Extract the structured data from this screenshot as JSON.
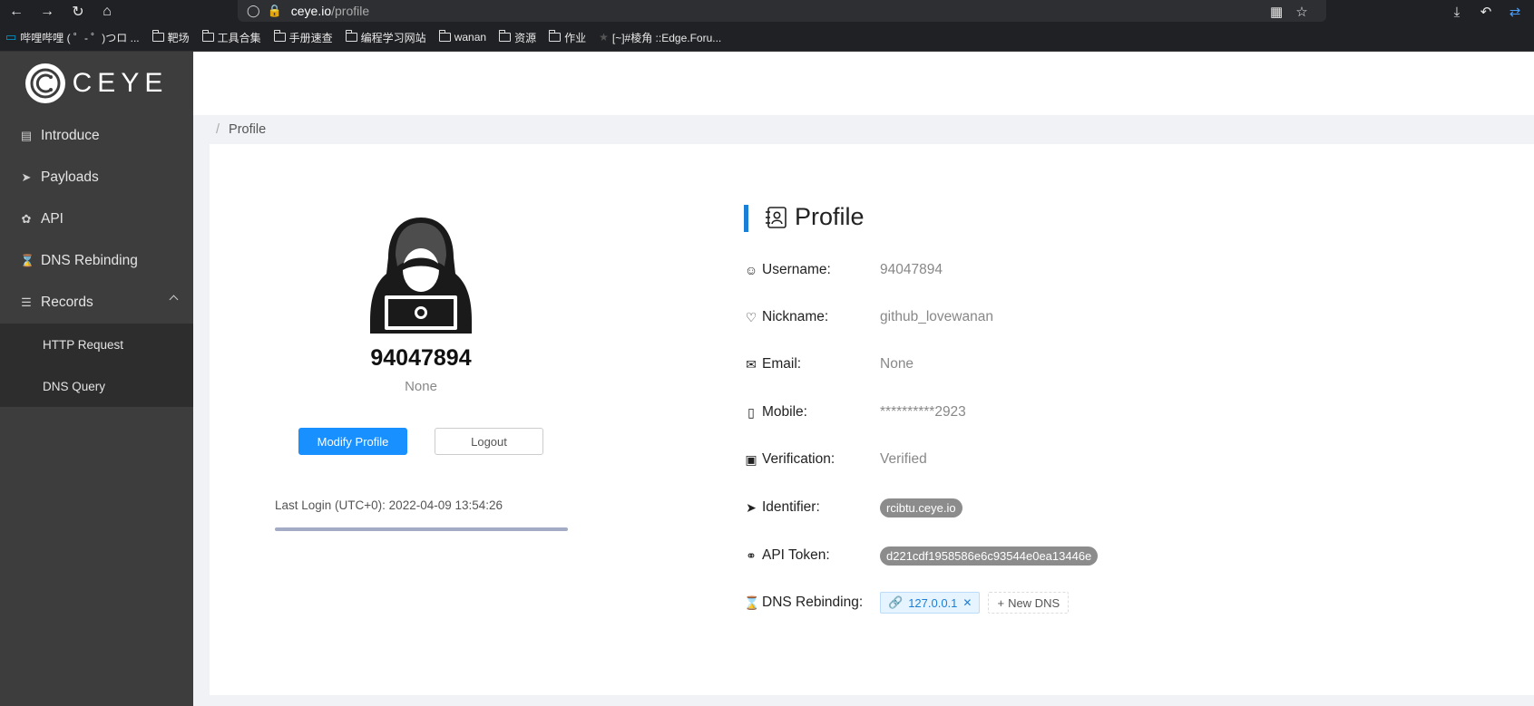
{
  "browser": {
    "url_host": "ceye.io",
    "url_path": "/profile",
    "bookmarks": [
      "哔哩哔哩 ( ゜- ゜)つロ ...",
      "靶场",
      "工具合集",
      "手册速查",
      "编程学习网站",
      "wanan",
      "资源",
      "作业",
      "[~]#棱角 ::Edge.Foru..."
    ]
  },
  "sidebar": {
    "logo_text": "CEYE",
    "items": [
      {
        "label": "Introduce",
        "icon": "book-icon"
      },
      {
        "label": "Payloads",
        "icon": "rocket-icon"
      },
      {
        "label": "API",
        "icon": "api-icon"
      },
      {
        "label": "DNS Rebinding",
        "icon": "hourglass-icon"
      },
      {
        "label": "Records",
        "icon": "list-icon"
      }
    ],
    "sub_items": [
      "HTTP Request",
      "DNS Query"
    ]
  },
  "breadcrumb": {
    "separator": "/",
    "current": "Profile"
  },
  "profile_card": {
    "username": "94047894",
    "nickname_display": "None",
    "modify_button": "Modify Profile",
    "logout_button": "Logout",
    "last_login": "Last Login (UTC+0): 2022-04-09 13:54:26"
  },
  "details": {
    "title": "Profile",
    "fields": [
      {
        "label": "Username:",
        "value": "94047894",
        "icon": "user-icon"
      },
      {
        "label": "Nickname:",
        "value": "github_lovewanan",
        "icon": "heart-icon"
      },
      {
        "label": "Email:",
        "value": "None",
        "icon": "mail-icon"
      },
      {
        "label": "Mobile:",
        "value": "**********2923",
        "icon": "mobile-icon"
      },
      {
        "label": "Verification:",
        "value": "Verified",
        "icon": "lock-icon"
      },
      {
        "label": "Identifier:",
        "value": "rcibtu.ceye.io",
        "icon": "rocket-icon"
      },
      {
        "label": "API Token:",
        "value": "d221cdf1958586e6c93544e0ea13446e",
        "icon": "key-icon"
      },
      {
        "label": "DNS Rebinding:",
        "value": "127.0.0.1",
        "icon": "hourglass-icon"
      }
    ],
    "new_dns_label": "New DNS"
  }
}
